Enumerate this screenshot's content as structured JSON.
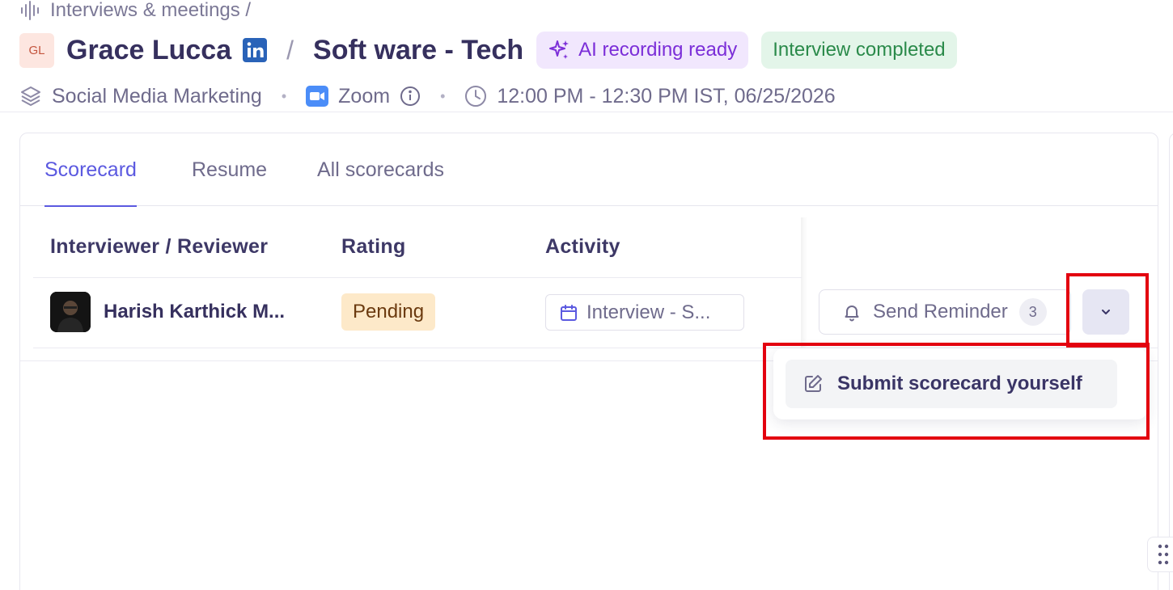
{
  "breadcrumb": {
    "text": "Interviews & meetings /"
  },
  "header": {
    "initials": "GL",
    "candidate_name": "Grace Lucca",
    "separator": "/",
    "role": "Soft ware - Tech",
    "ai_badge": "AI recording ready",
    "status_badge": "Interview completed"
  },
  "meta": {
    "department": "Social Media Marketing",
    "platform": "Zoom",
    "time": "12:00 PM - 12:30 PM IST, 06/25/2026",
    "bullet": "•"
  },
  "tabs": [
    {
      "label": "Scorecard",
      "active": true
    },
    {
      "label": "Resume",
      "active": false
    },
    {
      "label": "All scorecards",
      "active": false
    }
  ],
  "table": {
    "columns": [
      "Interviewer / Reviewer",
      "Rating",
      "Activity"
    ],
    "rows": [
      {
        "reviewer": "Harish Karthick M...",
        "rating": "Pending",
        "activity": "Interview - S...",
        "reminder_label": "Send Reminder",
        "reminder_count": "3"
      }
    ]
  },
  "dropdown": {
    "items": [
      {
        "label": "Submit scorecard yourself"
      }
    ]
  },
  "colors": {
    "accent": "#5b59e0",
    "ai_purple": "#7b2ed8",
    "success_green": "#2a8a4a",
    "pending_bg": "#fde9c9",
    "highlight_red": "#e3000f"
  }
}
